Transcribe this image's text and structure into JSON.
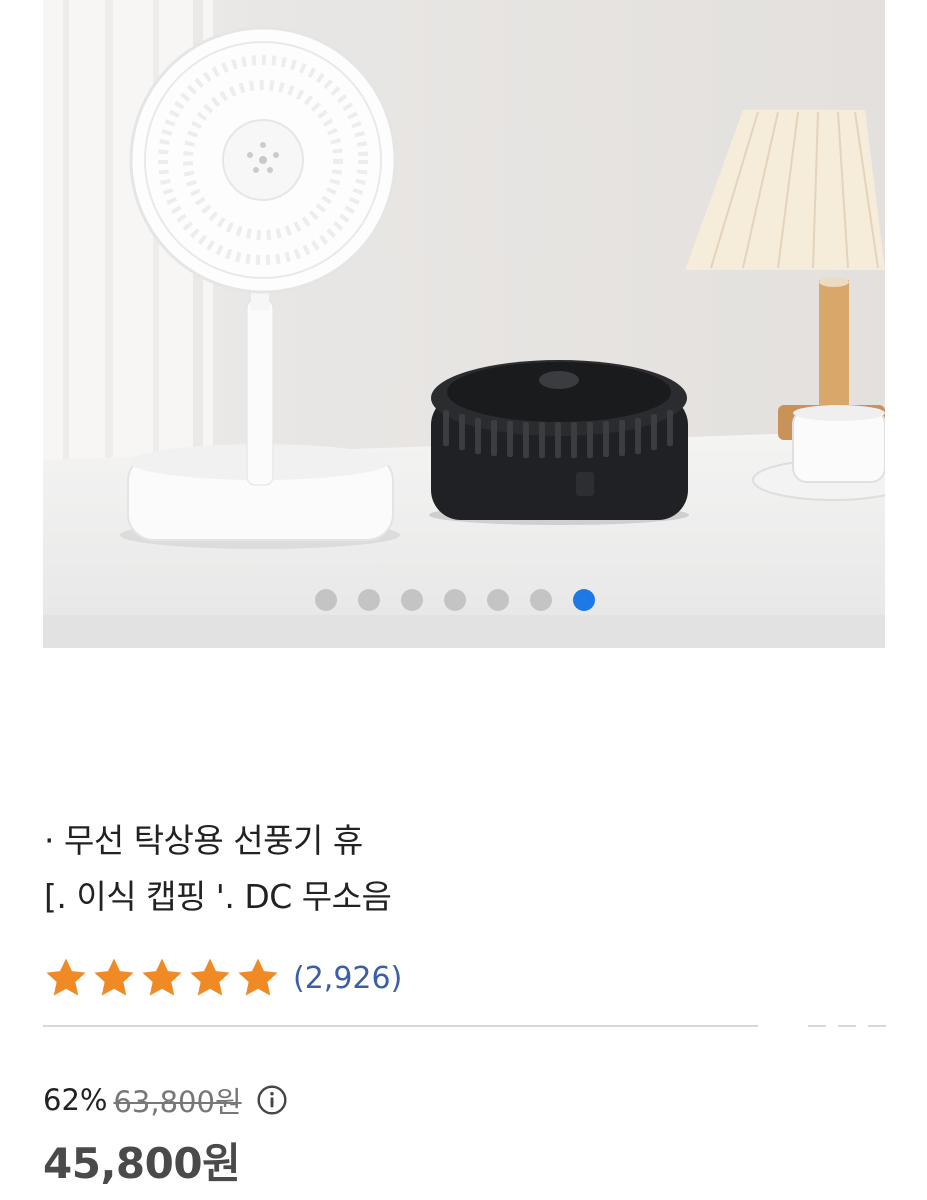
{
  "gallery": {
    "slide_count": 7,
    "active_index": 6,
    "image_alt": "white folding fan and black compact fan on table with lamp and cup"
  },
  "product": {
    "title_line1": "· 무선 탁상용 선풍기 휴",
    "title_line2": "[.    이식 캡핑 '. DC 무소음"
  },
  "rating": {
    "stars": 5,
    "review_count": "(2,926)"
  },
  "price": {
    "discount": "62%",
    "original": "63,800원",
    "sale": "45,800원"
  },
  "colors": {
    "star": "#f08a24",
    "active_dot": "#1e78e6",
    "review_link": "#3a5fa8"
  }
}
